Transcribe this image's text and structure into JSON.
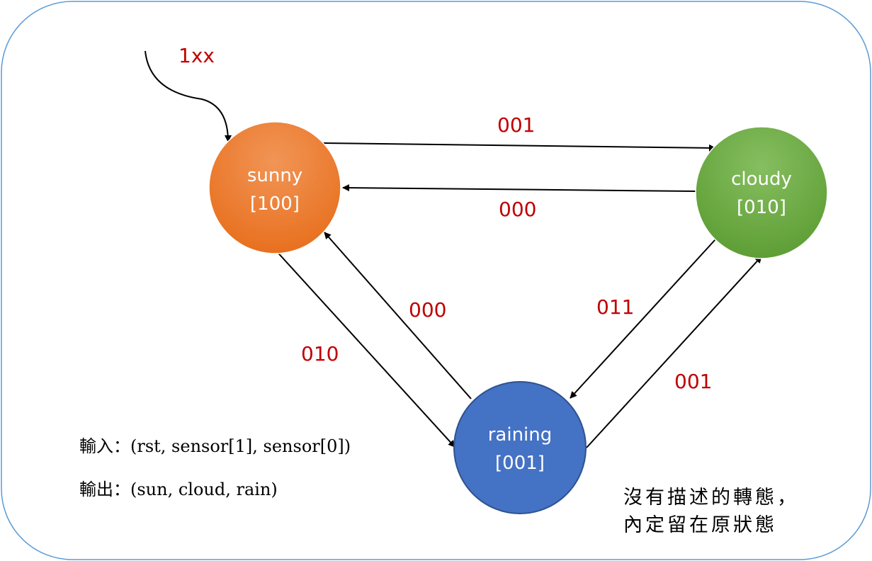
{
  "states": {
    "sunny": {
      "name": "sunny",
      "code": "[100]",
      "color": "#ed7d31"
    },
    "cloudy": {
      "name": "cloudy",
      "code": "[010]",
      "color": "#70ad47"
    },
    "raining": {
      "name": "raining",
      "code": "[001]",
      "color": "#4472c4"
    }
  },
  "transitions": {
    "reset": "1xx",
    "sunny_to_cloudy": "001",
    "cloudy_to_sunny": "000",
    "raining_to_sunny": "000",
    "sunny_to_raining": "010",
    "cloudy_to_raining": "011",
    "raining_to_cloudy": "001"
  },
  "notes": {
    "input": "輸入：(rst, sensor[1],  sensor[0])",
    "output": "輸出：(sun, cloud,  rain)",
    "default_line1": "沒有描述的轉態，",
    "default_line2": "內定留在原狀態"
  },
  "colors": {
    "border": "#5b9bd5",
    "label": "#c00000",
    "arrow": "#000000"
  }
}
